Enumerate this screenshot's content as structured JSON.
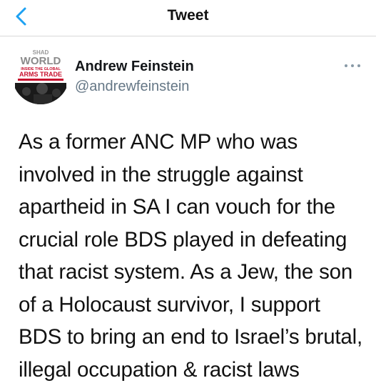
{
  "nav": {
    "title": "Tweet"
  },
  "author": {
    "name": "Andrew Feinstein",
    "handle": "@andrewfeinstein",
    "avatar": {
      "line1": "SHAD",
      "line2": "WORLD",
      "line3": "INSIDE THE GLOBAL",
      "line4": "ARMS TRADE"
    }
  },
  "tweet": {
    "lines": [
      "As a former ANC MP who was",
      "involved in the struggle against",
      "apartheid in SA I can vouch for the",
      "crucial role BDS played in defeating",
      "that racist system. As a Jew, the son",
      "of a Holocaust survivor, I support",
      "BDS to bring an end to Israel’s brutal,",
      "illegal occupation & racist laws"
    ]
  },
  "colors": {
    "accent": "#1da1f2",
    "handle": "#657786",
    "avatar_red": "#c8102e"
  },
  "icons": {
    "back": "chevron-left-icon",
    "more": "more-dots-icon"
  }
}
